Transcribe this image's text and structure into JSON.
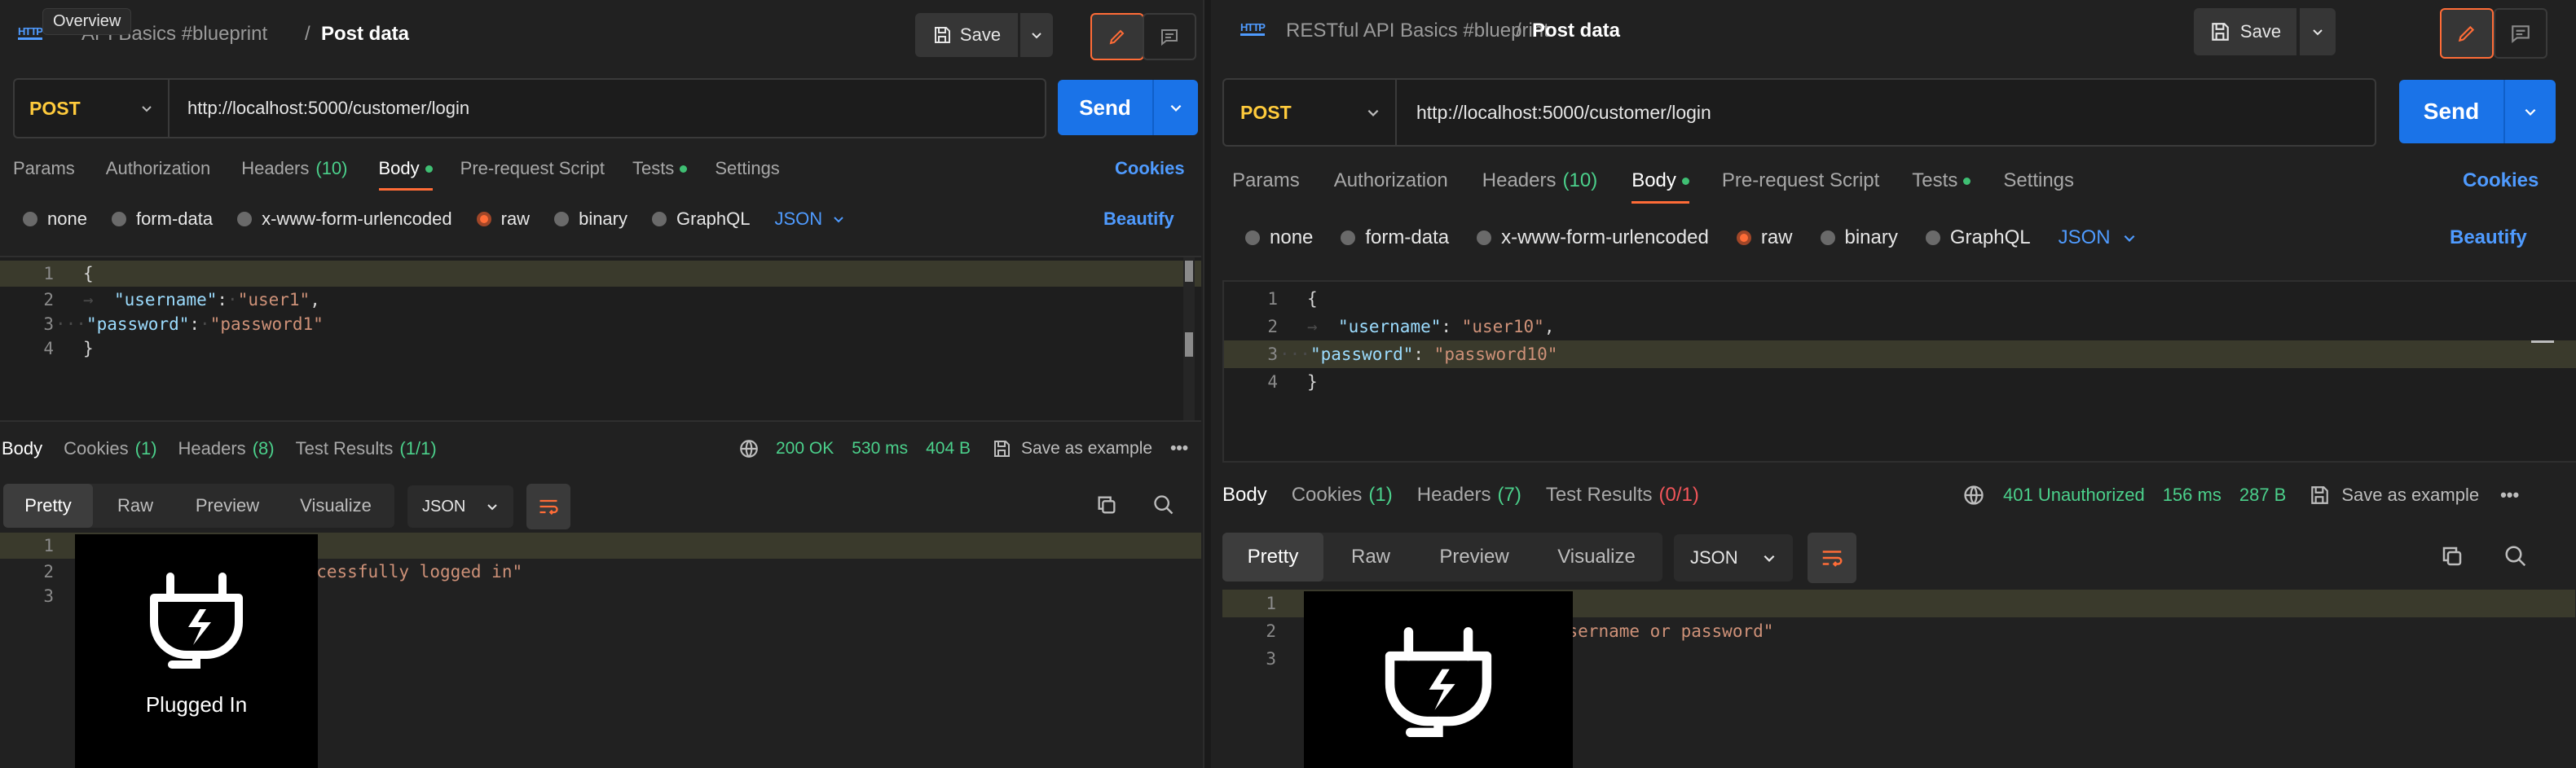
{
  "tooltip": "Overview",
  "plug_overlay_label": "Plugged In",
  "left": {
    "breadcrumb": "RESTful API Basics #blueprint",
    "breadcrumb_visible": "API Basics #blueprint",
    "title": "Post data",
    "save_label": "Save",
    "method": "POST",
    "url": "http://localhost:5000/customer/login",
    "send_label": "Send",
    "tabs": [
      {
        "label": "Params"
      },
      {
        "label": "Authorization"
      },
      {
        "label": "Headers",
        "count": "(10)"
      },
      {
        "label": "Body",
        "active": true,
        "dot": true
      },
      {
        "label": "Pre-request Script"
      },
      {
        "label": "Tests",
        "dot": true
      },
      {
        "label": "Settings"
      }
    ],
    "cookies_label": "Cookies",
    "body_types": [
      "none",
      "form-data",
      "x-www-form-urlencoded",
      "raw",
      "binary",
      "GraphQL"
    ],
    "selected_body_type": "raw",
    "body_format": "JSON",
    "beautify_label": "Beautify",
    "request_lines": [
      {
        "n": "1",
        "text": "{"
      },
      {
        "n": "2",
        "key": "\"username\"",
        "val": "\"user1\""
      },
      {
        "n": "3",
        "key": "\"password\"",
        "val": "\"password1\""
      },
      {
        "n": "4",
        "text": "}"
      }
    ],
    "resp_tabs": [
      {
        "label": "Body",
        "active": true
      },
      {
        "label": "Cookies",
        "count": "(1)"
      },
      {
        "label": "Headers",
        "count": "(8)"
      },
      {
        "label": "Test Results",
        "count": "(1/1)"
      }
    ],
    "status_code": "200 OK",
    "time": "530 ms",
    "size": "404 B",
    "save_example_label": "Save as example",
    "views": [
      "Pretty",
      "Raw",
      "Preview",
      "Visualize"
    ],
    "resp_format": "JSON",
    "response_lines": [
      {
        "n": "1",
        "text": "{"
      },
      {
        "n": "2",
        "key": "\"message\"",
        "val": "\"User successfully logged in\""
      },
      {
        "n": "3",
        "text": "}"
      }
    ]
  },
  "right": {
    "breadcrumb": "RESTful API Basics #blueprint",
    "title": "Post data",
    "save_label": "Save",
    "method": "POST",
    "url": "http://localhost:5000/customer/login",
    "send_label": "Send",
    "tabs": [
      {
        "label": "Params"
      },
      {
        "label": "Authorization"
      },
      {
        "label": "Headers",
        "count": "(10)"
      },
      {
        "label": "Body",
        "active": true,
        "dot": true
      },
      {
        "label": "Pre-request Script"
      },
      {
        "label": "Tests",
        "dot": true
      },
      {
        "label": "Settings"
      }
    ],
    "cookies_label": "Cookies",
    "body_types": [
      "none",
      "form-data",
      "x-www-form-urlencoded",
      "raw",
      "binary",
      "GraphQL"
    ],
    "selected_body_type": "raw",
    "body_format": "JSON",
    "beautify_label": "Beautify",
    "request_lines": [
      {
        "n": "1",
        "text": "{"
      },
      {
        "n": "2",
        "key": "\"username\"",
        "val": "\"user10\""
      },
      {
        "n": "3",
        "key": "\"password\"",
        "val": "\"password10\""
      },
      {
        "n": "4",
        "text": "}"
      }
    ],
    "resp_tabs": [
      {
        "label": "Body",
        "active": true
      },
      {
        "label": "Cookies",
        "count": "(1)"
      },
      {
        "label": "Headers",
        "count": "(7)"
      },
      {
        "label": "Test Results",
        "count": "(0/1)",
        "count_red": true
      }
    ],
    "status_code": "401 Unauthorized",
    "time": "156 ms",
    "size": "287 B",
    "save_example_label": "Save as example",
    "views": [
      "Pretty",
      "Raw",
      "Preview",
      "Visualize"
    ],
    "resp_format": "JSON",
    "response_lines": [
      {
        "n": "1",
        "text": "{"
      },
      {
        "n": "2",
        "key": "\"message\"",
        "val": "\"Invalid username or password\""
      },
      {
        "n": "3",
        "text": "}"
      }
    ]
  },
  "colors": {
    "background": "#212121",
    "accent_orange": "#ff6c37",
    "send_blue": "#1a73e8",
    "method_yellow": "#ffcb3c",
    "success_green": "#4bd08b",
    "error_red": "#f2555a",
    "link_blue": "#4f9bff"
  },
  "icons": [
    "http-icon",
    "save-icon",
    "chevron-down-icon",
    "pencil-icon",
    "comment-icon",
    "globe-icon",
    "more-icon",
    "copy-icon",
    "search-icon",
    "wrap-icon",
    "plug-icon"
  ]
}
